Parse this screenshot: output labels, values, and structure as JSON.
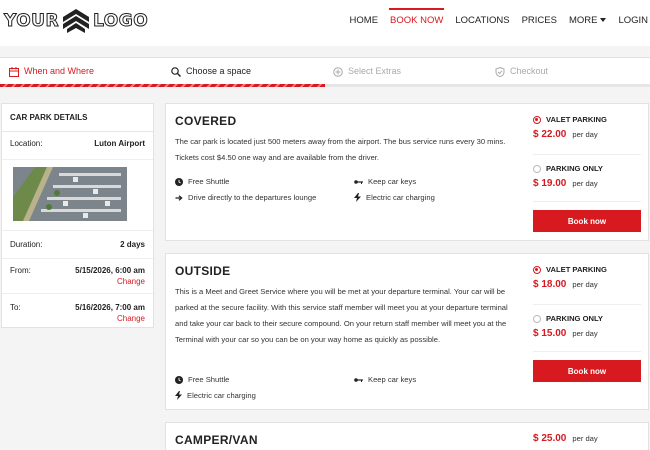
{
  "header": {
    "logo_left": "YOUR",
    "logo_right": "LOGO",
    "nav": [
      "HOME",
      "BOOK NOW",
      "LOCATIONS",
      "PRICES",
      "MORE",
      "LOGIN"
    ]
  },
  "steps": {
    "items": [
      "When and Where",
      "Choose a space",
      "Select Extras",
      "Checkout"
    ],
    "current": 2,
    "progress_fraction": 0.5
  },
  "sidebar": {
    "title": "CAR PARK DETAILS",
    "location_label": "Location:",
    "location_value": "Luton Airport",
    "duration_label": "Duration:",
    "duration_value": "2 days",
    "from_label": "From:",
    "from_value": "5/15/2026, 6:00 am",
    "to_label": "To:",
    "to_value": "5/16/2026, 7:00 am",
    "change_label": "Change"
  },
  "cards": [
    {
      "title": "COVERED",
      "description": "The car park is located just 500 meters away from the airport. The bus service runs every 30 mins. Tickets cost $4.50 one way and are available from the driver.",
      "features": [
        "Free Shuttle",
        "Keep car keys",
        "Drive directly to the departures lounge",
        "Electric car charging"
      ],
      "options": [
        {
          "name": "VALET PARKING",
          "price": "$ 22.00",
          "per": "per day",
          "selected": true
        },
        {
          "name": "PARKING ONLY",
          "price": "$ 19.00",
          "per": "per day",
          "selected": false
        }
      ],
      "button": "Book now"
    },
    {
      "title": "OUTSIDE",
      "description": "This is a Meet and Greet Service where you will be met at your departure terminal. Your car will be parked at the secure facility. With this service staff member will meet you at your departure terminal and take your car back to their secure compound. On your return staff member will meet you at the Terminal with your car so you can be on your way home as quickly as possible.",
      "features": [
        "Free Shuttle",
        "Keep car keys",
        "Electric car charging"
      ],
      "options": [
        {
          "name": "VALET PARKING",
          "price": "$ 18.00",
          "per": "per day",
          "selected": true
        },
        {
          "name": "PARKING ONLY",
          "price": "$ 15.00",
          "per": "per day",
          "selected": false
        }
      ],
      "button": "Book now"
    },
    {
      "title": "CAMPER/VAN",
      "options": [
        {
          "price": "$ 25.00",
          "per": "per day"
        }
      ]
    }
  ],
  "colors": {
    "accent": "#d71920",
    "background": "#f4f4f4",
    "card": "#ffffff"
  }
}
